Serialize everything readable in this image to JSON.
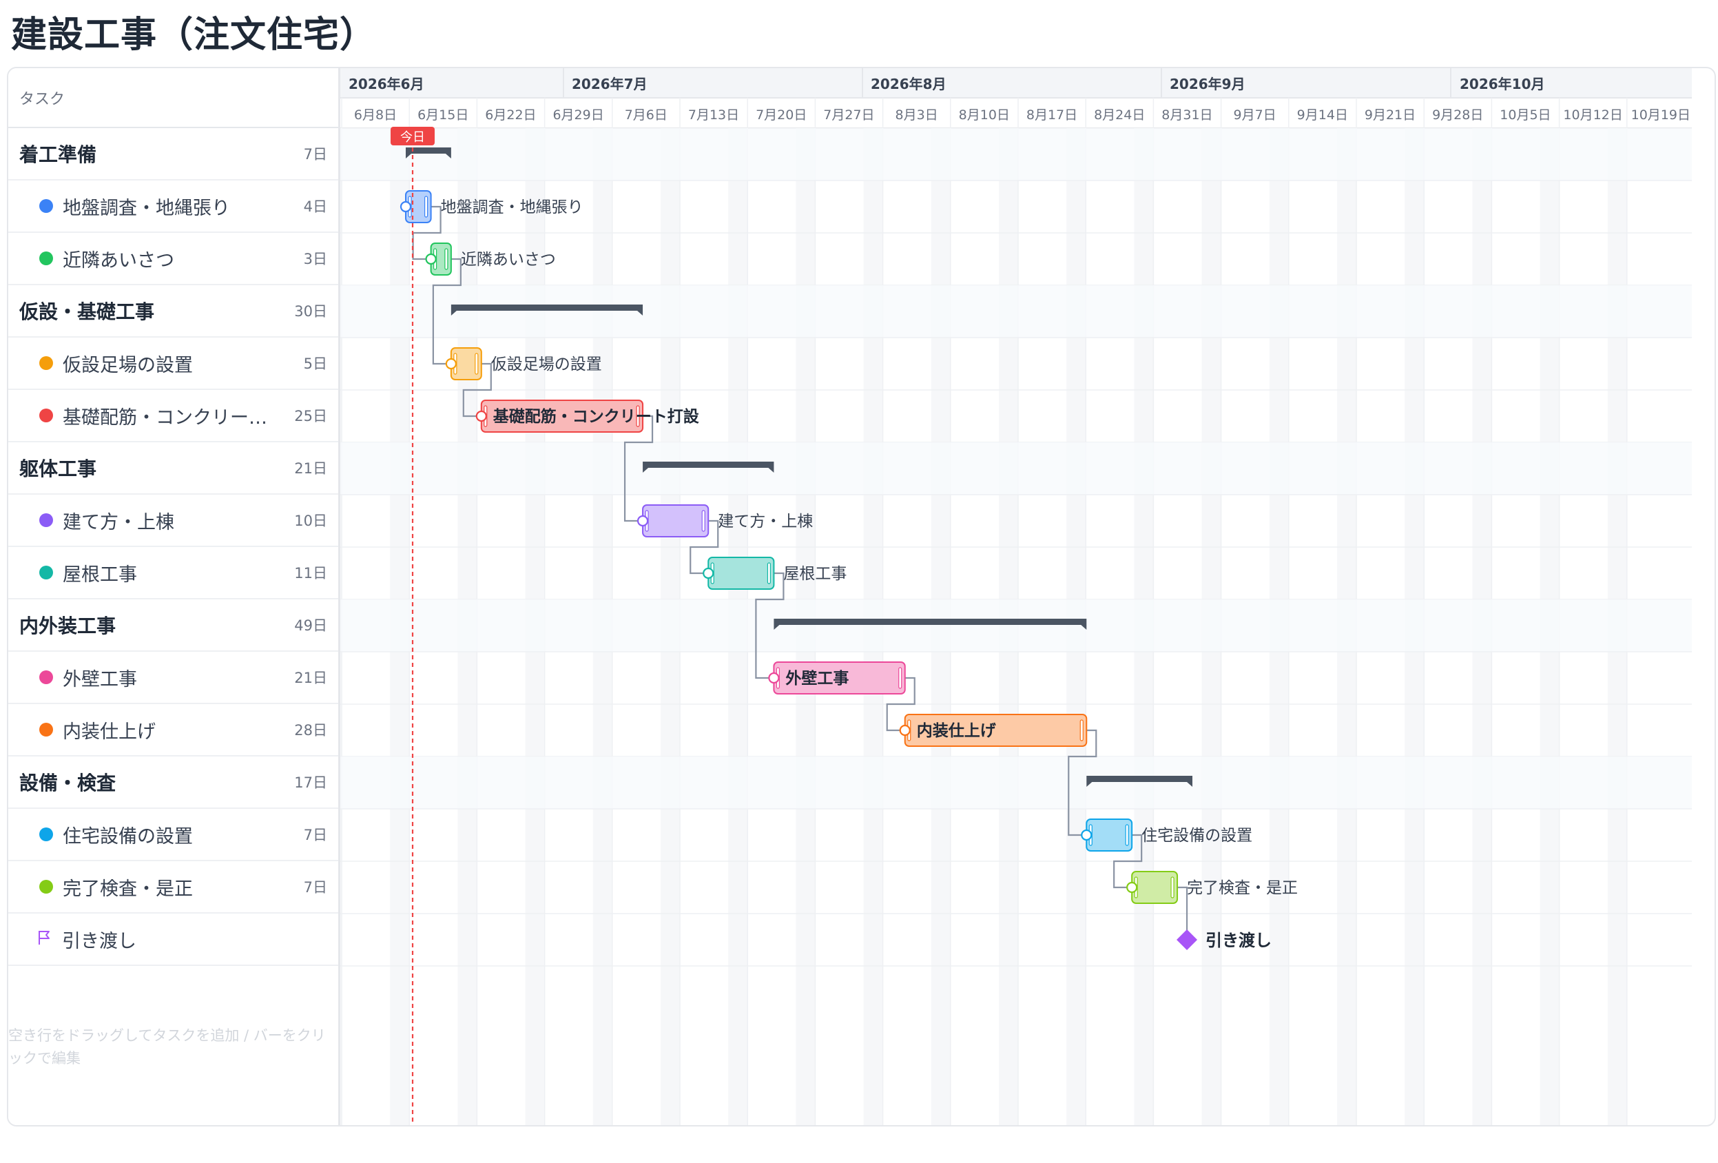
{
  "title": "建設工事（注文住宅）",
  "left_header": "タスク",
  "timeline": {
    "months": [
      "2026年6月",
      "2026年7月",
      "2026年8月",
      "2026年9月",
      "2026年10月"
    ],
    "weeks": [
      "6月8日",
      "6月15日",
      "6月22日",
      "6月29日",
      "7月6日",
      "7月13日",
      "7月20日",
      "7月27日",
      "8月3日",
      "8月10日",
      "8月17日",
      "8月24日",
      "8月31日",
      "9月7日",
      "9月14日",
      "9月21日",
      "9月28日",
      "10月5日",
      "10月12日",
      "10月19日"
    ],
    "today_label": "今日"
  },
  "tasks": [
    {
      "type": "group",
      "name": "着工準備",
      "duration": "7日"
    },
    {
      "type": "task",
      "name": "地盤調査・地縄張り",
      "duration": "4日",
      "color": "#3b82f6"
    },
    {
      "type": "task",
      "name": "近隣あいさつ",
      "duration": "3日",
      "color": "#22c55e"
    },
    {
      "type": "group",
      "name": "仮設・基礎工事",
      "duration": "30日"
    },
    {
      "type": "task",
      "name": "仮設足場の設置",
      "duration": "5日",
      "color": "#f59e0b"
    },
    {
      "type": "task",
      "name": "基礎配筋・コンクリー…",
      "bar_label": "基礎配筋・コンクリート打設",
      "duration": "25日",
      "color": "#ef4444"
    },
    {
      "type": "group",
      "name": "躯体工事",
      "duration": "21日"
    },
    {
      "type": "task",
      "name": "建て方・上棟",
      "duration": "10日",
      "color": "#8b5cf6"
    },
    {
      "type": "task",
      "name": "屋根工事",
      "duration": "11日",
      "color": "#14b8a6"
    },
    {
      "type": "group",
      "name": "内外装工事",
      "duration": "49日"
    },
    {
      "type": "task",
      "name": "外壁工事",
      "duration": "21日",
      "color": "#ec4899"
    },
    {
      "type": "task",
      "name": "内装仕上げ",
      "duration": "28日",
      "color": "#f97316"
    },
    {
      "type": "group",
      "name": "設備・検査",
      "duration": "17日"
    },
    {
      "type": "task",
      "name": "住宅設備の設置",
      "duration": "7日",
      "color": "#0ea5e9"
    },
    {
      "type": "task",
      "name": "完了検査・是正",
      "bar_label": "完了検査・是正",
      "duration": "7日",
      "color": "#84cc16"
    },
    {
      "type": "milestone",
      "name": "引き渡し",
      "color": "#a855f7"
    }
  ],
  "hint": "空き行をドラッグしてタスクを追加 / バーをクリックで編集"
}
